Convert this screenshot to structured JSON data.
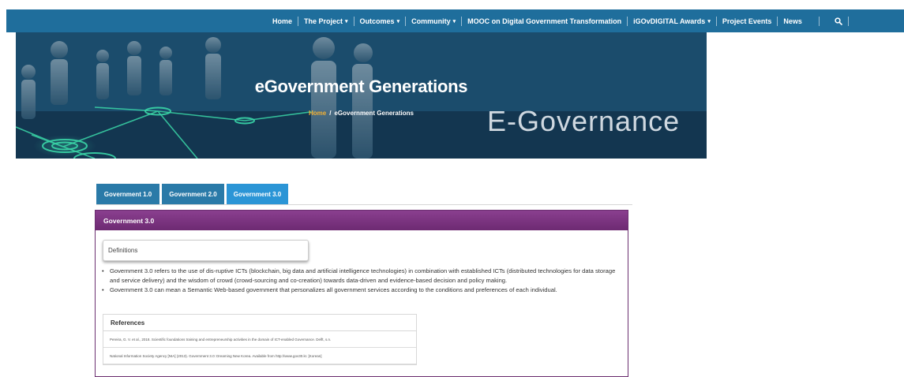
{
  "nav": {
    "items": [
      {
        "label": "Home",
        "dropdown": false
      },
      {
        "label": "The Project",
        "dropdown": true
      },
      {
        "label": "Outcomes",
        "dropdown": true
      },
      {
        "label": "Community",
        "dropdown": true
      },
      {
        "label": "MOOC on Digital Government Transformation",
        "dropdown": false
      },
      {
        "label": "iGOvDIGITAL Awards",
        "dropdown": true
      },
      {
        "label": "Project Events",
        "dropdown": false
      },
      {
        "label": "News",
        "dropdown": false
      }
    ],
    "caret": "▾",
    "search_icon": "search-icon",
    "colors": {
      "bar": "#1f6e9c",
      "text": "#ffffff"
    }
  },
  "hero": {
    "title": "eGovernment Generations",
    "breadcrumb": {
      "home": "Home",
      "separator": "/",
      "current": "eGovernment Generations"
    },
    "image_text": "E-Governance",
    "colors": {
      "home_link": "#f2b134",
      "net_glow": "#3ad6a8"
    }
  },
  "tabs": [
    {
      "label": "Government 1.0",
      "active": false
    },
    {
      "label": "Government 2.0",
      "active": false
    },
    {
      "label": "Government 3.0",
      "active": true
    }
  ],
  "panel": {
    "title": "Government 3.0",
    "definitions_label": "Definitions",
    "bullets": [
      "Government 3.0 refers to the use of dis-ruptive ICTs (blockchain, big data and artificial intelligence technologies) in combination with established ICTs (distributed technologies for data storage and service delivery) and the wisdom of crowd (crowd-sourcing and co-creation) towards data-driven and evidence-based decision and policy making.",
      "Government 3.0 can mean a Semantic Web-based government that personalizes all government services according to the conditions and preferences of each individual."
    ],
    "references_title": "References",
    "references": [
      "Pereira, G. V. et al., 2018. Scientific foundations training and entrepreneurship activities in the domain of ICT-enabled Governance. Delft, s.n.",
      "National Information Society Agency [NIA] (2013). Government 3.0: Dreaming New Korea. Available from http://www.gov30.kr. [Korean]"
    ],
    "colors": {
      "header": "#6d2a72",
      "tab": "#2a7aa8",
      "tab_active": "#2b95d6"
    }
  }
}
